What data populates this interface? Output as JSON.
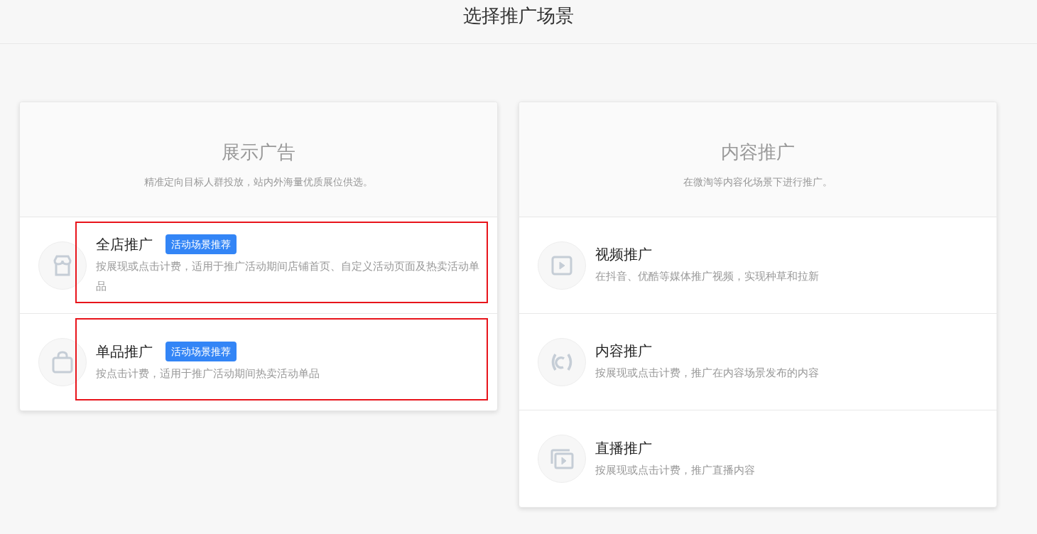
{
  "header": {
    "title": "选择推广场景"
  },
  "panels": [
    {
      "title": "展示广告",
      "subtitle": "精准定向目标人群投放，站内外海量优质展位供选。",
      "items": [
        {
          "kind": "store",
          "title": "全店推广",
          "badge": "活动场景推荐",
          "description": "按展现或点击计费，适用于推广活动期间店铺首页、自定义活动页面及热卖活动单品",
          "highlighted": true
        },
        {
          "kind": "bag",
          "title": "单品推广",
          "badge": "活动场景推荐",
          "description": "按点击计费，适用于推广活动期间热卖活动单品",
          "highlighted": true
        }
      ]
    },
    {
      "title": "内容推广",
      "subtitle": "在微淘等内容化场景下进行推广。",
      "items": [
        {
          "kind": "video",
          "title": "视频推广",
          "description": "在抖音、优酷等媒体推广视频，实现种草和拉新",
          "highlighted": false
        },
        {
          "kind": "content",
          "title": "内容推广",
          "description": "按展现或点击计费，推广在内容场景发布的内容",
          "highlighted": false
        },
        {
          "kind": "live",
          "title": "直播推广",
          "description": "按展现或点击计费，推广直播内容",
          "highlighted": false
        }
      ]
    }
  ]
}
